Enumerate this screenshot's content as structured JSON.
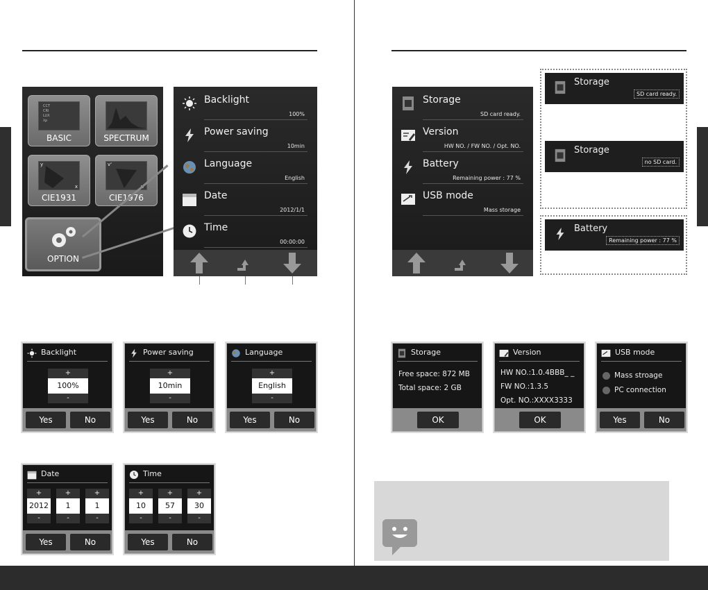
{
  "main_menu": {
    "buttons": [
      {
        "label": "BASIC",
        "icon": "basic-chart-icon",
        "legend": [
          "CCT",
          "CRI",
          "LUX",
          "λp"
        ]
      },
      {
        "label": "SPECTRUM",
        "icon": "spectrum-graph-icon"
      },
      {
        "label": "CIE1931",
        "icon": "cie1931-diagram-icon",
        "axis_y": "y",
        "axis_x": "x"
      },
      {
        "label": "CIE1976",
        "icon": "cie1976-diagram-icon",
        "axis_y": "v'",
        "axis_x": "u'"
      }
    ],
    "option": {
      "label": "OPTION",
      "icon": "gears-icon"
    }
  },
  "option_menu": {
    "items": [
      {
        "title": "Backlight",
        "value": "100%",
        "icon": "sun-icon"
      },
      {
        "title": "Power saving",
        "value": "10min",
        "icon": "lightning-icon"
      },
      {
        "title": "Language",
        "value": "English",
        "icon": "globe-icon"
      },
      {
        "title": "Date",
        "value": "2012/1/1",
        "icon": "calendar-icon"
      },
      {
        "title": "Time",
        "value": "00:00:00",
        "icon": "clock-icon"
      }
    ]
  },
  "system_menu": {
    "items": [
      {
        "title": "Storage",
        "value": "SD card ready.",
        "icon": "sd-card-icon"
      },
      {
        "title": "Version",
        "value": "HW NO. / FW NO. / Opt. NO.",
        "icon": "version-doc-icon"
      },
      {
        "title": "Battery",
        "value": "Remaining power : 77 %",
        "icon": "lightning-icon"
      },
      {
        "title": "USB mode",
        "value": "Mass storage",
        "icon": "usb-icon"
      }
    ]
  },
  "callouts": [
    {
      "title": "Storage",
      "value": "SD card ready."
    },
    {
      "title": "Storage",
      "value": "no SD card."
    },
    {
      "title": "Battery",
      "value": "Remaining power : 77 %"
    }
  ],
  "dialogs": {
    "yes": "Yes",
    "no": "No",
    "ok": "OK",
    "plus": "+",
    "minus": "-",
    "backlight": {
      "title": "Backlight",
      "value": "100%"
    },
    "power_saving": {
      "title": "Power saving",
      "value": "10min"
    },
    "language": {
      "title": "Language",
      "value": "English"
    },
    "date": {
      "title": "Date",
      "values": [
        "2012",
        "1",
        "1"
      ]
    },
    "time": {
      "title": "Time",
      "values": [
        "10",
        "57",
        "30"
      ]
    },
    "storage": {
      "title": "Storage",
      "lines": [
        "Free space: 872 MB",
        "Total space: 2 GB"
      ]
    },
    "version": {
      "title": "Version",
      "lines": [
        "HW NO.:1.0.4BBB_ _",
        "FW NO.:1.3.5",
        "Opt. NO.:XXXX3333"
      ]
    },
    "usb": {
      "title": "USB mode",
      "options": [
        "Mass stroage",
        "PC connection"
      ]
    }
  },
  "colors": {
    "screen_bg": "#1c1c1c",
    "button_bar": "#8a8a8a",
    "footer": "#2c2c2c",
    "note_bg": "#d8d8d8"
  }
}
